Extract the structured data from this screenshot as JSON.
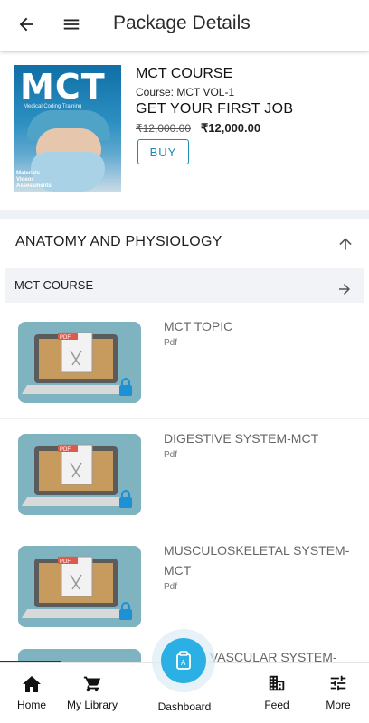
{
  "header": {
    "title": "Package Details"
  },
  "package": {
    "cover": {
      "brand": "MCT",
      "brand_sub": "Medical Coding Training",
      "tags": [
        "Materials",
        "Videos",
        "Assessments"
      ]
    },
    "name": "MCT COURSE",
    "course": "Course: MCT VOL-1",
    "tagline": "GET YOUR FIRST JOB",
    "price_old": "₹12,000.00",
    "price_new": "₹12,000.00",
    "buy_label": "BUY"
  },
  "section": {
    "title": "ANATOMY AND PHYSIOLOGY"
  },
  "subsection": {
    "title": "MCT COURSE"
  },
  "items": [
    {
      "title": "MCT TOPIC",
      "type": "Pdf"
    },
    {
      "title": "DIGESTIVE SYSTEM-MCT",
      "type": "Pdf"
    },
    {
      "title": "MUSCULOSKELETAL SYSTEM-MCT",
      "type": "Pdf"
    }
  ],
  "peek_item": {
    "title": "VASCULAR SYSTEM-"
  },
  "nav": {
    "home": "Home",
    "library": "My Library",
    "dashboard": "Dashboard",
    "feed": "Feed",
    "more": "More"
  },
  "colors": {
    "accent": "#2ab0e4",
    "buy_border": "#1c8bb3",
    "thumb_bg": "#7fb3bf"
  }
}
